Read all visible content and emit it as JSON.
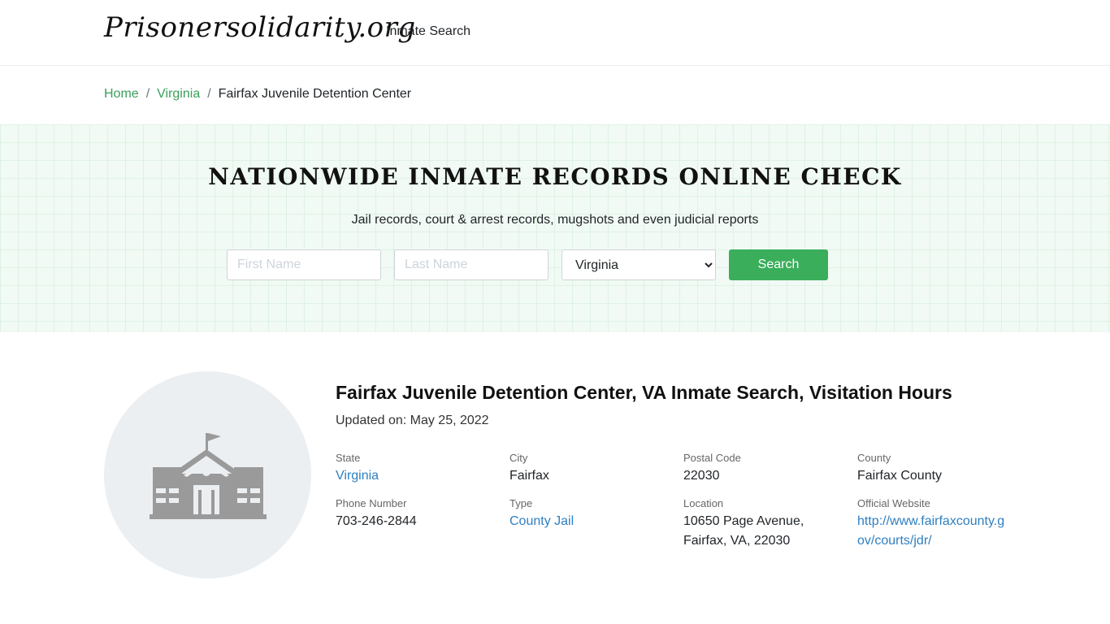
{
  "header": {
    "logo": "Prisonersolidarity.org",
    "nav": {
      "inmate_search": "Inmate Search"
    }
  },
  "breadcrumb": {
    "home": "Home",
    "state": "Virginia",
    "current": "Fairfax Juvenile Detention Center",
    "separator": "/"
  },
  "hero": {
    "title": "NATIONWIDE INMATE RECORDS ONLINE CHECK",
    "subtitle": "Jail records, court & arrest records, mugshots and even judicial reports",
    "first_name_placeholder": "First Name",
    "last_name_placeholder": "Last Name",
    "state_selected": "Virginia",
    "search_label": "Search"
  },
  "facility": {
    "title": "Fairfax Juvenile Detention Center, VA Inmate Search, Visitation Hours",
    "updated": "Updated on: May 25, 2022",
    "icon": "building-icon",
    "fields": {
      "state": {
        "label": "State",
        "value": "Virginia"
      },
      "city": {
        "label": "City",
        "value": "Fairfax"
      },
      "postal_code": {
        "label": "Postal Code",
        "value": "22030"
      },
      "county": {
        "label": "County",
        "value": "Fairfax County"
      },
      "phone": {
        "label": "Phone Number",
        "value": "703-246-2844"
      },
      "type": {
        "label": "Type",
        "value": "County Jail"
      },
      "location": {
        "label": "Location",
        "line1": "10650 Page Avenue,",
        "line2": "Fairfax, VA, 22030"
      },
      "website": {
        "label": "Official Website",
        "value": "http://www.fairfaxcounty.gov/courts/jdr/"
      }
    }
  },
  "colors": {
    "accent_green": "#3aae5b",
    "link_green": "#3aa05a",
    "link_blue": "#2f7fc1",
    "hero_bg": "#f1faf4",
    "avatar_bg": "#eceff2",
    "icon_gray": "#9a9a9a"
  }
}
